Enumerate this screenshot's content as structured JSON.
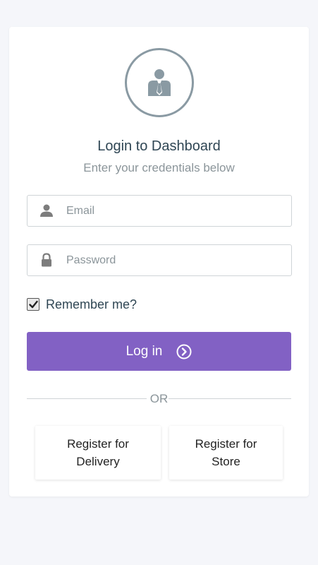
{
  "header": {
    "title": "Login to Dashboard",
    "subtitle": "Enter your credentials below"
  },
  "form": {
    "email_placeholder": "Email",
    "password_placeholder": "Password",
    "remember_label": "Remember me?",
    "remember_checked": true,
    "login_label": "Log in"
  },
  "divider": {
    "text": "OR"
  },
  "register": {
    "delivery_line1": "Register for",
    "delivery_line2": "Delivery",
    "store_line1": "Register for",
    "store_line2": "Store"
  },
  "colors": {
    "accent": "#8261c4",
    "avatar_stroke": "#8a9aa3",
    "title": "#2f4654",
    "muted": "#8b959a",
    "background": "#f5f6fa"
  },
  "icons": {
    "avatar": "user-tie-icon",
    "email": "user-icon",
    "password": "lock-icon",
    "login_arrow": "chevron-circle-right-icon",
    "check": "checkmark-icon"
  }
}
